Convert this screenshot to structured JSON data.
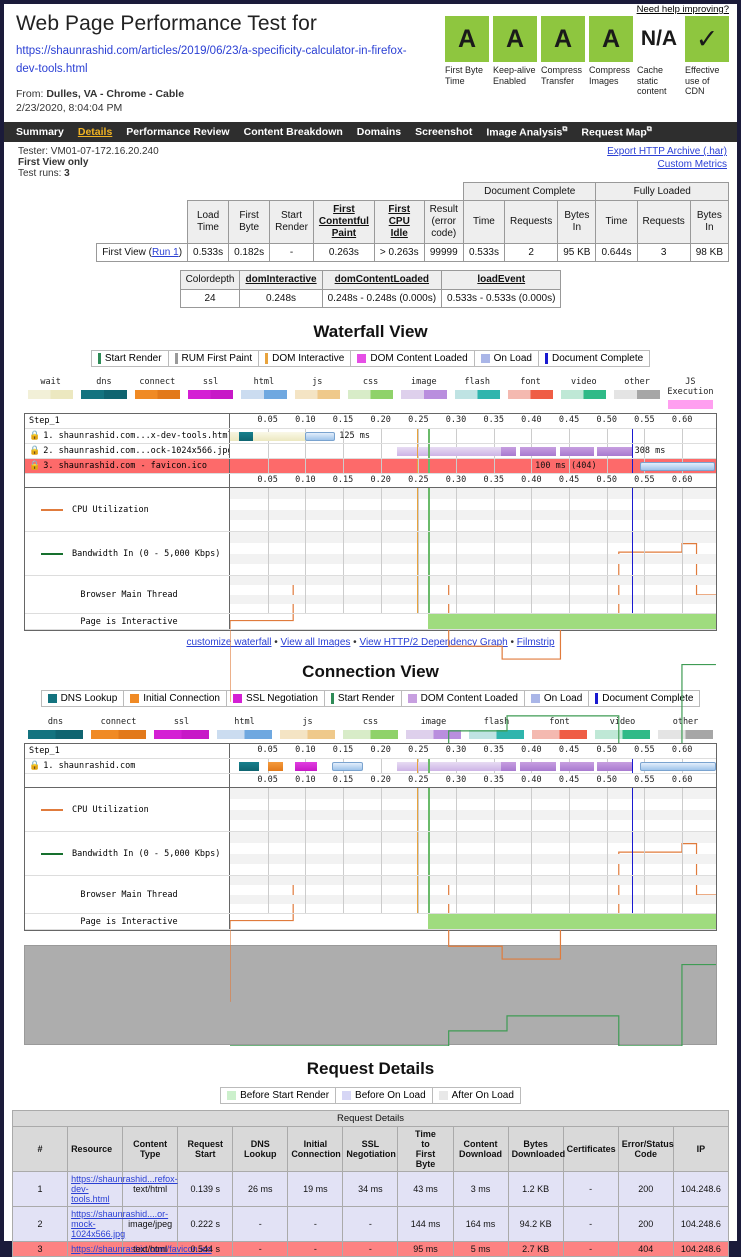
{
  "header": {
    "title": "Web Page Performance Test for",
    "url": "https://shaunrashid.com/articles/2019/06/23/a-specificity-calculator-in-firefox-dev-tools.html",
    "help_link": "Need help improving?",
    "from_label": "From:",
    "from_value": "Dulles, VA - Chrome - Cable",
    "timestamp": "2/23/2020, 8:04:04 PM",
    "grades": [
      {
        "grade": "A",
        "label": "First Byte Time",
        "color": "#8ec63f"
      },
      {
        "grade": "A",
        "label": "Keep-alive Enabled",
        "color": "#8ec63f"
      },
      {
        "grade": "A",
        "label": "Compress Transfer",
        "color": "#8ec63f"
      },
      {
        "grade": "A",
        "label": "Compress Images",
        "color": "#8ec63f"
      },
      {
        "grade": "N/A",
        "label": "Cache static content",
        "color": "#ffffff"
      },
      {
        "grade": "✓",
        "label": "Effective use of CDN",
        "color": "#8ec63f"
      }
    ]
  },
  "nav": {
    "items": [
      {
        "label": "Summary",
        "active": false,
        "external": false
      },
      {
        "label": "Details",
        "active": true,
        "external": false
      },
      {
        "label": "Performance Review",
        "active": false,
        "external": false
      },
      {
        "label": "Content Breakdown",
        "active": false,
        "external": false
      },
      {
        "label": "Domains",
        "active": false,
        "external": false
      },
      {
        "label": "Screenshot",
        "active": false,
        "external": false
      },
      {
        "label": "Image Analysis",
        "active": false,
        "external": true
      },
      {
        "label": "Request Map",
        "active": false,
        "external": true
      }
    ]
  },
  "test_info": {
    "tester": "Tester: VM01-07-172.16.20.240",
    "view": "First View only",
    "runs_label": "Test runs:",
    "runs_value": "3",
    "links": [
      "Export HTTP Archive (.har)",
      "Custom Metrics"
    ]
  },
  "metrics_table": {
    "group_headers": [
      "Document Complete",
      "Fully Loaded"
    ],
    "columns": [
      {
        "label": "Load Time",
        "underline": false
      },
      {
        "label": "First Byte",
        "underline": false
      },
      {
        "label": "Start Render",
        "underline": false
      },
      {
        "label": "First Contentful Paint",
        "underline": true
      },
      {
        "label": "First CPU Idle",
        "underline": true
      },
      {
        "label": "Result (error code)",
        "underline": false
      },
      {
        "label": "Time",
        "underline": false
      },
      {
        "label": "Requests",
        "underline": false
      },
      {
        "label": "Bytes In",
        "underline": false
      },
      {
        "label": "Time",
        "underline": false
      },
      {
        "label": "Requests",
        "underline": false
      },
      {
        "label": "Bytes In",
        "underline": false
      }
    ],
    "row_label": "First View (",
    "row_link": "Run 1",
    "row_label_end": ")",
    "values": [
      "0.533s",
      "0.182s",
      "-",
      "0.263s",
      "> 0.263s",
      "99999",
      "0.533s",
      "2",
      "95 KB",
      "0.644s",
      "3",
      "98 KB"
    ]
  },
  "dom_table": {
    "columns": [
      {
        "label": "Colordepth",
        "underline": false
      },
      {
        "label": "domInteractive",
        "underline": true
      },
      {
        "label": "domContentLoaded",
        "underline": true
      },
      {
        "label": "loadEvent",
        "underline": true
      }
    ],
    "values": [
      "24",
      "0.248s",
      "0.248s - 0.248s (0.000s)",
      "0.533s - 0.533s (0.000s)"
    ]
  },
  "waterfall": {
    "title": "Waterfall View",
    "legend": [
      {
        "label": "Start Render",
        "color": "#2e8b57",
        "shape": "line"
      },
      {
        "label": "RUM First Paint",
        "color": "#999999",
        "shape": "line"
      },
      {
        "label": "DOM Interactive",
        "color": "#e8a33d",
        "shape": "line"
      },
      {
        "label": "DOM Content Loaded",
        "color": "#e64fe6",
        "shape": "box"
      },
      {
        "label": "On Load",
        "color": "#aab6e8",
        "shape": "box"
      },
      {
        "label": "Document Complete",
        "color": "#1a1ad0",
        "shape": "line"
      }
    ],
    "type_key": [
      {
        "label": "wait",
        "c1": "#f2f0d8",
        "c2": "#ece8c0"
      },
      {
        "label": "dns",
        "c1": "#13737f",
        "c2": "#0f6470"
      },
      {
        "label": "connect",
        "c1": "#f08a24",
        "c2": "#e2791a"
      },
      {
        "label": "ssl",
        "c1": "#d41fd4",
        "c2": "#c718c7"
      },
      {
        "label": "html",
        "c1": "#cbdcf0",
        "c2": "#6fa8e0"
      },
      {
        "label": "js",
        "c1": "#f4e4c4",
        "c2": "#efc98b"
      },
      {
        "label": "css",
        "c1": "#d8ecc8",
        "c2": "#8fd26a"
      },
      {
        "label": "image",
        "c1": "#ded0ec",
        "c2": "#b98ede"
      },
      {
        "label": "flash",
        "c1": "#bfe3e3",
        "c2": "#2fb5ad"
      },
      {
        "label": "font",
        "c1": "#f4b9b0",
        "c2": "#ef5d45"
      },
      {
        "label": "video",
        "c1": "#bfe8d6",
        "c2": "#2fba87"
      },
      {
        "label": "other",
        "c1": "#e4e4e4",
        "c2": "#a6a6a6"
      },
      {
        "label": "JS Execution",
        "c1": "#ff9ff0",
        "c2": "#ff9ff0"
      }
    ],
    "step_label": "Step_1",
    "ticks": [
      "0.05",
      "0.10",
      "0.15",
      "0.20",
      "0.25",
      "0.30",
      "0.35",
      "0.40",
      "0.45",
      "0.50",
      "0.55",
      "0.60"
    ],
    "requests": [
      {
        "num": "1",
        "name": "1. shaunrashid.com...x-dev-tools.html",
        "duration_label": "125 ms",
        "error": false
      },
      {
        "num": "2",
        "name": "2. shaunrashid.com...ock-1024x566.jpg",
        "duration_label": "308 ms",
        "error": false
      },
      {
        "num": "3",
        "name": "3. shaunrashid.com - favicon.ico",
        "duration_label": "100 ms (404)",
        "error": true
      }
    ],
    "tracks": [
      {
        "label": "CPU Utilization",
        "color": "#e07b3c"
      },
      {
        "label": "Bandwidth In (0 - 5,000 Kbps)",
        "color": "#16702e"
      },
      {
        "label": "Browser Main Thread",
        "color": "#666666"
      },
      {
        "label": "Page is Interactive",
        "color": "#9fdc7e"
      }
    ],
    "footer_links": [
      "customize waterfall",
      "View all Images",
      "View HTTP/2 Dependency Graph",
      "Filmstrip"
    ],
    "footer_sep": "•"
  },
  "connection": {
    "title": "Connection View",
    "legend": [
      {
        "label": "DNS Lookup",
        "color": "#13737f",
        "shape": "box"
      },
      {
        "label": "Initial Connection",
        "color": "#f08a24",
        "shape": "box"
      },
      {
        "label": "SSL Negotiation",
        "color": "#d41fd4",
        "shape": "box"
      },
      {
        "label": "Start Render",
        "color": "#2e8b57",
        "shape": "line"
      },
      {
        "label": "DOM Content Loaded",
        "color": "#c79fe0",
        "shape": "box"
      },
      {
        "label": "On Load",
        "color": "#aab6e8",
        "shape": "box"
      },
      {
        "label": "Document Complete",
        "color": "#1a1ad0",
        "shape": "line"
      }
    ],
    "type_key": [
      {
        "label": "dns",
        "c1": "#13737f",
        "c2": "#0f6470"
      },
      {
        "label": "connect",
        "c1": "#f08a24",
        "c2": "#e2791a"
      },
      {
        "label": "ssl",
        "c1": "#d41fd4",
        "c2": "#c718c7"
      },
      {
        "label": "html",
        "c1": "#cbdcf0",
        "c2": "#6fa8e0"
      },
      {
        "label": "js",
        "c1": "#f4e4c4",
        "c2": "#efc98b"
      },
      {
        "label": "css",
        "c1": "#d8ecc8",
        "c2": "#8fd26a"
      },
      {
        "label": "image",
        "c1": "#ded0ec",
        "c2": "#b98ede"
      },
      {
        "label": "flash",
        "c1": "#bfe3e3",
        "c2": "#2fb5ad"
      },
      {
        "label": "font",
        "c1": "#f4b9b0",
        "c2": "#ef5d45"
      },
      {
        "label": "video",
        "c1": "#bfe8d6",
        "c2": "#2fba87"
      },
      {
        "label": "other",
        "c1": "#e4e4e4",
        "c2": "#a6a6a6"
      }
    ],
    "step_label": "Step_1",
    "ticks": [
      "0.05",
      "0.10",
      "0.15",
      "0.20",
      "0.25",
      "0.30",
      "0.35",
      "0.40",
      "0.45",
      "0.50",
      "0.55",
      "0.60"
    ],
    "connections": [
      {
        "name": "1. shaunrashid.com"
      }
    ],
    "tracks": [
      {
        "label": "CPU Utilization",
        "color": "#e07b3c"
      },
      {
        "label": "Bandwidth In (0 - 5,000 Kbps)",
        "color": "#16702e"
      },
      {
        "label": "Browser Main Thread",
        "color": "#666666"
      },
      {
        "label": "Page is Interactive",
        "color": "#9fdc7e"
      }
    ]
  },
  "request_details": {
    "title": "Request Details",
    "caption": "Request Details",
    "legend": [
      {
        "label": "Before Start Render",
        "color": "#ccf0cc"
      },
      {
        "label": "Before On Load",
        "color": "#d6d6f5"
      },
      {
        "label": "After On Load",
        "color": "#e8e8e8"
      }
    ],
    "columns": [
      "#",
      "Resource",
      "Content Type",
      "Request Start",
      "DNS Lookup",
      "Initial Connection",
      "SSL Negotiation",
      "Time to First Byte",
      "Content Download",
      "Bytes Downloaded",
      "Certificates",
      "Error/Status Code",
      "IP"
    ],
    "rows": [
      {
        "num": "1",
        "resource": "https://shaunrashid...refox-dev-tools.html",
        "content_type": "text/html",
        "request_start": "0.139 s",
        "dns_lookup": "26 ms",
        "initial_connection": "19 ms",
        "ssl_negotiation": "34 ms",
        "ttfb": "43 ms",
        "content_download": "3 ms",
        "bytes_downloaded": "1.2 KB",
        "certificates": "-",
        "status": "200",
        "ip": "104.248.6",
        "style": "before"
      },
      {
        "num": "2",
        "resource": "https://shaunrashid....or-mock-1024x566.jpg",
        "content_type": "image/jpeg",
        "request_start": "0.222 s",
        "dns_lookup": "-",
        "initial_connection": "-",
        "ssl_negotiation": "-",
        "ttfb": "144 ms",
        "content_download": "164 ms",
        "bytes_downloaded": "94.2 KB",
        "certificates": "-",
        "status": "200",
        "ip": "104.248.6",
        "style": "before"
      },
      {
        "num": "3",
        "resource": "https://shaunrashid.com/favicon.ico",
        "content_type": "text/html",
        "request_start": "0.544 s",
        "dns_lookup": "-",
        "initial_connection": "-",
        "ssl_negotiation": "-",
        "ttfb": "95 ms",
        "content_download": "5 ms",
        "bytes_downloaded": "2.7 KB",
        "certificates": "-",
        "status": "404",
        "ip": "104.248.6",
        "style": "error"
      }
    ]
  }
}
